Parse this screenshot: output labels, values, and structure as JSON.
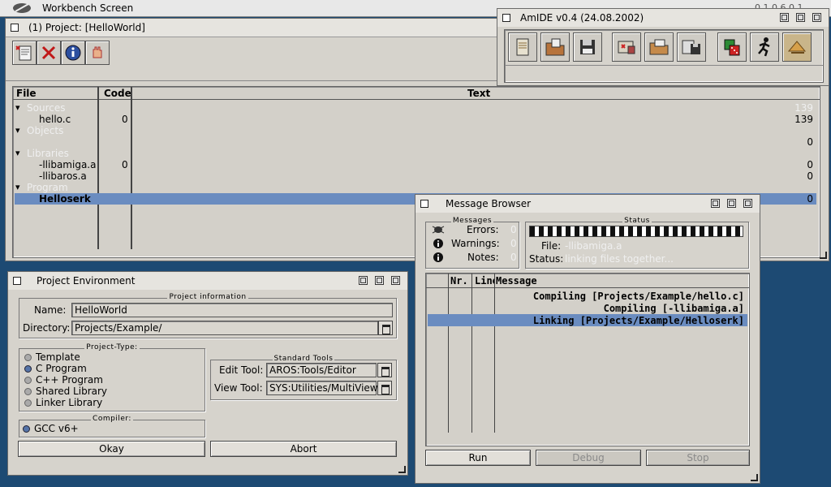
{
  "screen": {
    "title": "Workbench Screen",
    "clock": "0.1  0.6  0.1"
  },
  "project_window": {
    "title": "(1) Project: [HelloWorld]",
    "toolbar": [
      "new-project-icon",
      "delete-icon",
      "info-icon",
      "stop-hand-icon"
    ],
    "columns": {
      "file": "File",
      "code": "Code",
      "text": "Text"
    },
    "rows": [
      {
        "file": "Sources",
        "code": "",
        "text": "139",
        "type": "group"
      },
      {
        "file": "hello.c",
        "code": "0",
        "text": "139",
        "type": "item"
      },
      {
        "file": "Objects",
        "code": "",
        "text": "",
        "type": "group"
      },
      {
        "file": "",
        "code": "",
        "text": "0",
        "type": "item"
      },
      {
        "file": "Libraries",
        "code": "",
        "text": "",
        "type": "group"
      },
      {
        "file": "-llibamiga.a",
        "code": "0",
        "text": "0",
        "type": "item"
      },
      {
        "file": "-llibaros.a",
        "code": "",
        "text": "0",
        "type": "item"
      },
      {
        "file": "Program",
        "code": "",
        "text": "",
        "type": "group"
      },
      {
        "file": "Helloserk",
        "code": "",
        "text": "0",
        "type": "selected"
      }
    ]
  },
  "amide_window": {
    "title": "AmIDE v0.4 (24.08.2002)",
    "toolbar": [
      "new-file-icon",
      "open-file-icon",
      "save-disk-icon",
      "project-icon",
      "open-folder-icon",
      "save-project-icon",
      "dice-icon",
      "run-icon",
      "settings-icon"
    ]
  },
  "project_env": {
    "title": "Project Environment",
    "info_group": "Project information",
    "name_label": "Name:",
    "name_value": "HelloWorld",
    "dir_label": "Directory:",
    "dir_value": "Projects/Example/",
    "type_group": "Project-Type:",
    "types": [
      {
        "label": "Template",
        "selected": false
      },
      {
        "label": "C Program",
        "selected": true
      },
      {
        "label": "C++ Program",
        "selected": false
      },
      {
        "label": "Shared Library",
        "selected": false
      },
      {
        "label": "Linker Library",
        "selected": false
      }
    ],
    "tools_group": "Standard Tools",
    "edit_tool_label": "Edit Tool:",
    "edit_tool_value": "AROS:Tools/Editor",
    "view_tool_label": "View Tool:",
    "view_tool_value": "SYS:Utilities/MultiView",
    "compiler_group": "Compiler:",
    "compiler": "GCC v6+",
    "okay": "Okay",
    "abort": "Abort"
  },
  "message_browser": {
    "title": "Message Browser",
    "messages_group": "Messages",
    "errors_label": "Errors:",
    "errors_value": "0",
    "warnings_label": "Warnings:",
    "warnings_value": "0",
    "notes_label": "Notes:",
    "notes_value": "0",
    "status_group": "Status",
    "file_label": "File:",
    "file_value": "-llibamiga.a",
    "status_label": "Status:",
    "status_value": "linking files together...",
    "columns": {
      "nr": "Nr.",
      "line": "Line",
      "message": "Message"
    },
    "rows": [
      {
        "text": "Compiling [Projects/Example/hello.c]",
        "selected": false
      },
      {
        "text": "Compiling [-llibamiga.a]",
        "selected": false
      },
      {
        "text": "Linking [Projects/Example/Helloserk]",
        "selected": true
      }
    ],
    "run": "Run",
    "debug": "Debug",
    "stop": "Stop"
  },
  "colors": {
    "selection": "#6a8cc0",
    "desktop": "#1d4a73",
    "window": "#d6d3cc"
  }
}
